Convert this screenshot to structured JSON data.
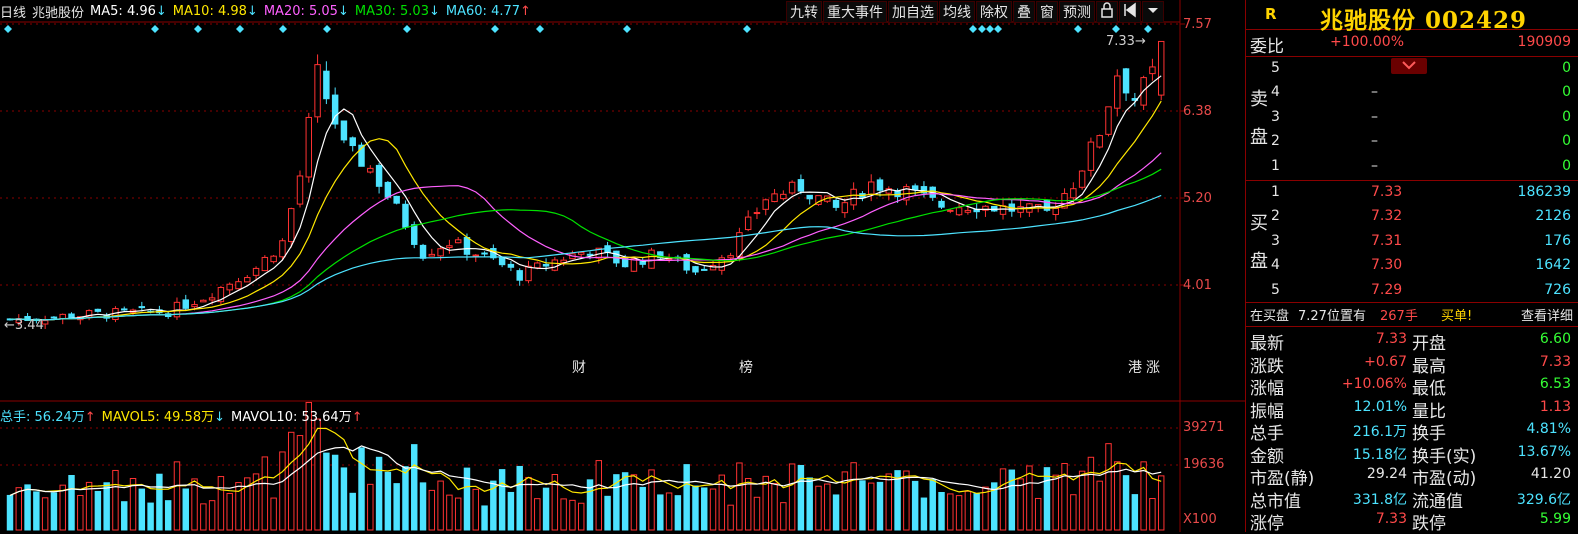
{
  "header": {
    "period": "日线",
    "stock_name": "兆驰股份",
    "ma5": {
      "label": "MA5:",
      "value": "4.96",
      "arrow": "↓",
      "color": "#ffffff"
    },
    "ma10": {
      "label": "MA10:",
      "value": "4.98",
      "arrow": "↓",
      "color": "#ffe800"
    },
    "ma20": {
      "label": "MA20:",
      "value": "5.05",
      "arrow": "↓",
      "color": "#ff60ff"
    },
    "ma30": {
      "label": "MA30:",
      "value": "5.03",
      "arrow": "↓",
      "color": "#00e000"
    },
    "ma60": {
      "label": "MA60:",
      "value": "4.77",
      "arrow": "↑",
      "color": "#4de3ff"
    }
  },
  "toolbar": {
    "buttons": [
      "九转",
      "重大事件",
      "加自选",
      "均线",
      "除权",
      "叠",
      "窗",
      "预测"
    ],
    "icons": [
      "lock-icon",
      "pin-icon",
      "dropdown-icon"
    ]
  },
  "price_axis": [
    "7.57",
    "6.38",
    "5.20",
    "4.01"
  ],
  "volume_axis": [
    "39271",
    "19636",
    "X100"
  ],
  "annotations": {
    "max_price": "7.33",
    "min_price": "3.44",
    "events": [
      "财",
      "榜",
      "港",
      "涨"
    ]
  },
  "volume_header": {
    "total": {
      "label": "总手:",
      "value": "56.24万",
      "arrow": "↑",
      "color": "#4de3ff"
    },
    "mavol5": {
      "label": "MAVOL5:",
      "value": "49.58万",
      "arrow": "↓",
      "color": "#ffe800"
    },
    "mavol10": {
      "label": "MAVOL10:",
      "value": "53.64万",
      "arrow": "↑",
      "color": "#ffffff"
    }
  },
  "colors": {
    "up": "#ff3232",
    "down": "#4de3ff",
    "grid": "#8a0000",
    "ma5": "#ffffff",
    "ma10": "#ffe800",
    "ma20": "#ff60ff",
    "ma30": "#00e000",
    "ma60": "#4de3ff"
  },
  "chart_data": {
    "type": "candlestick",
    "price_ticks": [
      7.57,
      6.38,
      5.2,
      4.01
    ],
    "max_price": 7.33,
    "min_price": 3.44,
    "volume_ticks": [
      39271,
      19636
    ],
    "volume_unit": "X100",
    "last_ma": {
      "MA5": 4.96,
      "MA10": 4.98,
      "MA20": 5.05,
      "MA30": 5.03,
      "MA60": 4.77
    }
  },
  "panel": {
    "code_badge": "R",
    "title": "兆驰股份 002429",
    "webi": {
      "label": "委比",
      "pct": "+100.00%",
      "diff": "190909"
    },
    "sell_label": [
      "卖",
      "盘"
    ],
    "buy_label": [
      "买",
      "盘"
    ],
    "sell": [
      {
        "lv": "5",
        "price": "",
        "vol": "0"
      },
      {
        "lv": "4",
        "price": "–",
        "vol": "0"
      },
      {
        "lv": "3",
        "price": "–",
        "vol": "0"
      },
      {
        "lv": "2",
        "price": "–",
        "vol": "0"
      },
      {
        "lv": "1",
        "price": "–",
        "vol": "0"
      }
    ],
    "buy": [
      {
        "lv": "1",
        "price": "7.33",
        "vol": "186239"
      },
      {
        "lv": "2",
        "price": "7.32",
        "vol": "2126"
      },
      {
        "lv": "3",
        "price": "7.31",
        "vol": "176"
      },
      {
        "lv": "4",
        "price": "7.30",
        "vol": "1642"
      },
      {
        "lv": "5",
        "price": "7.29",
        "vol": "726"
      }
    ],
    "info": {
      "prefix": "在买盘",
      "price_pos": "7.27位置有",
      "qty": "267手",
      "tag": "买单!",
      "link": "查看详细"
    },
    "quotes": [
      {
        "l": "最新",
        "v": "7.33",
        "c": "red",
        "l2": "开盘",
        "v2": "6.60",
        "c2": "green"
      },
      {
        "l": "涨跌",
        "v": "+0.67",
        "c": "red",
        "l2": "最高",
        "v2": "7.33",
        "c2": "red"
      },
      {
        "l": "涨幅",
        "v": "+10.06%",
        "c": "red",
        "l2": "最低",
        "v2": "6.53",
        "c2": "green"
      },
      {
        "l": "振幅",
        "v": "12.01%",
        "c": "cyan",
        "l2": "量比",
        "v2": "1.13",
        "c2": "red"
      },
      {
        "l": "总手",
        "v": "216.1万",
        "c": "cyan",
        "l2": "换手",
        "v2": "4.81%",
        "c2": "cyan"
      },
      {
        "l": "金额",
        "v": "15.18亿",
        "c": "cyan",
        "l2": "换手(实)",
        "v2": "13.67%",
        "c2": "cyan"
      },
      {
        "l": "市盈(静)",
        "v": "29.24",
        "c": "white",
        "l2": "市盈(动)",
        "v2": "41.20",
        "c2": "white"
      },
      {
        "l": "总市值",
        "v": "331.8亿",
        "c": "cyan",
        "l2": "流通值",
        "v2": "329.6亿",
        "c2": "cyan"
      },
      {
        "l": "涨停",
        "v": "7.33",
        "c": "red",
        "l2": "跌停",
        "v2": "5.99",
        "c2": "green"
      }
    ]
  }
}
